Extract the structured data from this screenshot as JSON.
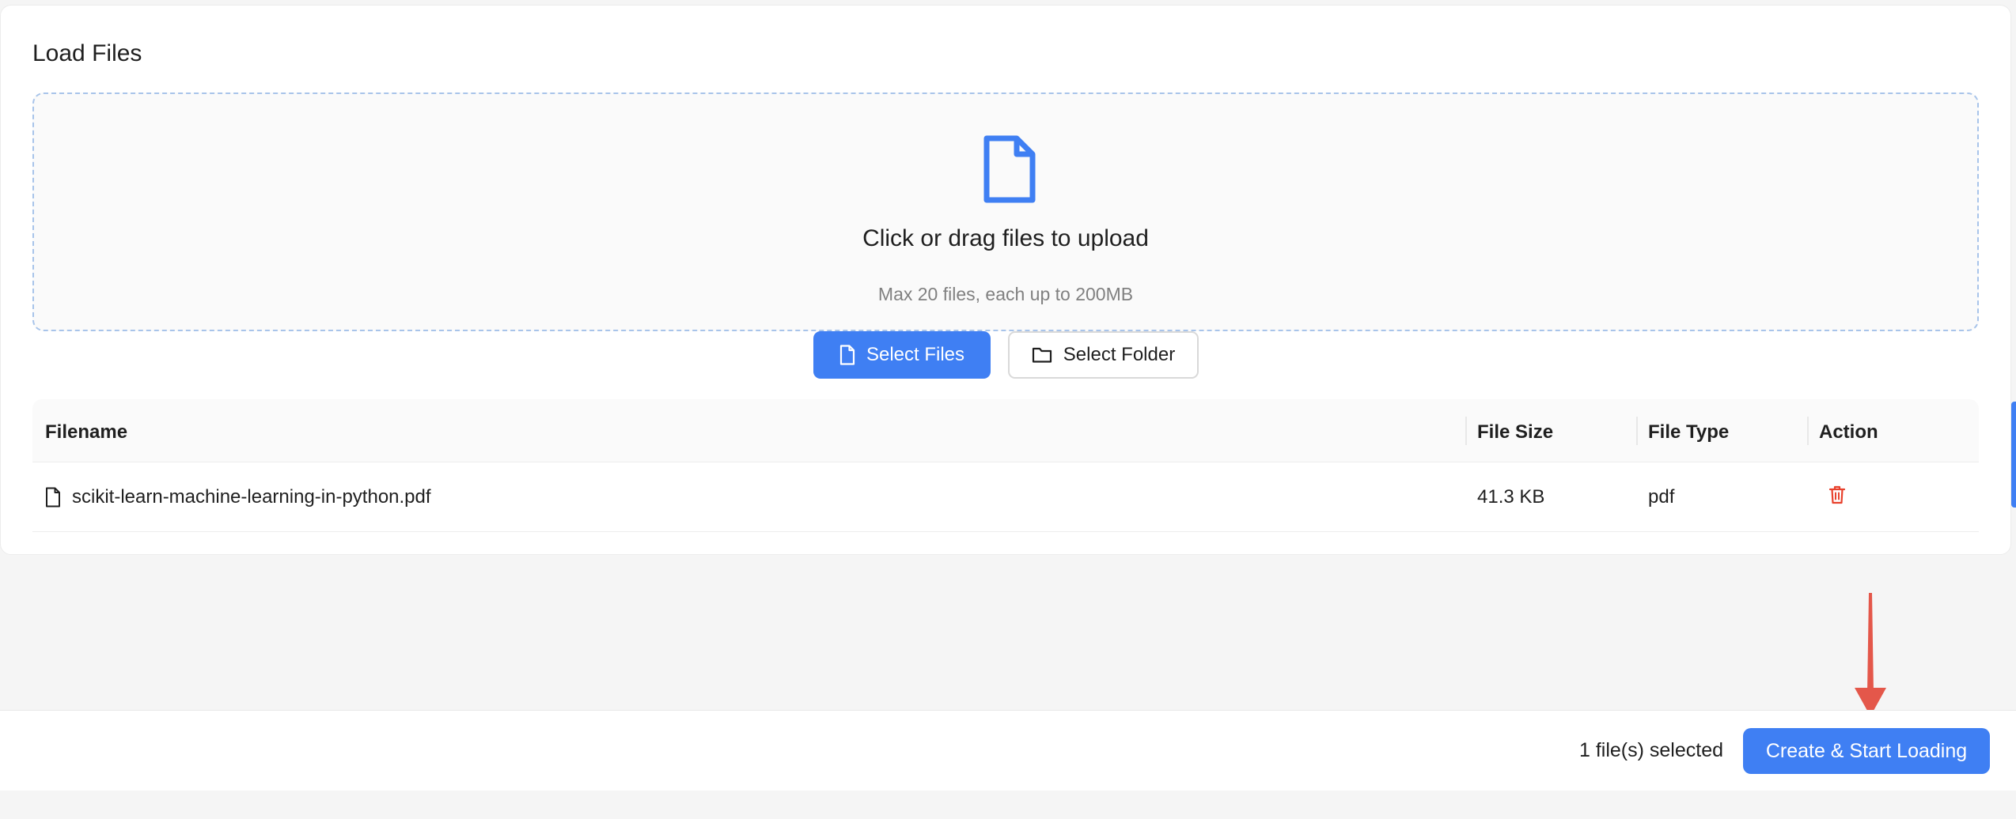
{
  "card": {
    "title": "Load Files"
  },
  "dropzone": {
    "icon": "file-icon",
    "title": "Click or drag files to upload",
    "hint": "Max 20 files, each up to 200MB"
  },
  "buttons": {
    "select_files": "Select Files",
    "select_folder": "Select Folder"
  },
  "table": {
    "headers": {
      "filename": "Filename",
      "file_size": "File Size",
      "file_type": "File Type",
      "action": "Action"
    },
    "rows": [
      {
        "filename": "scikit-learn-machine-learning-in-python.pdf",
        "file_size": "41.3 KB",
        "file_type": "pdf",
        "action_icon": "trash-icon"
      }
    ]
  },
  "footer": {
    "selected_count": "1 file(s) selected",
    "start_button": "Create & Start Loading"
  },
  "colors": {
    "primary": "#3f7ff3",
    "danger": "#e8412c",
    "annotation": "#e4574a"
  }
}
